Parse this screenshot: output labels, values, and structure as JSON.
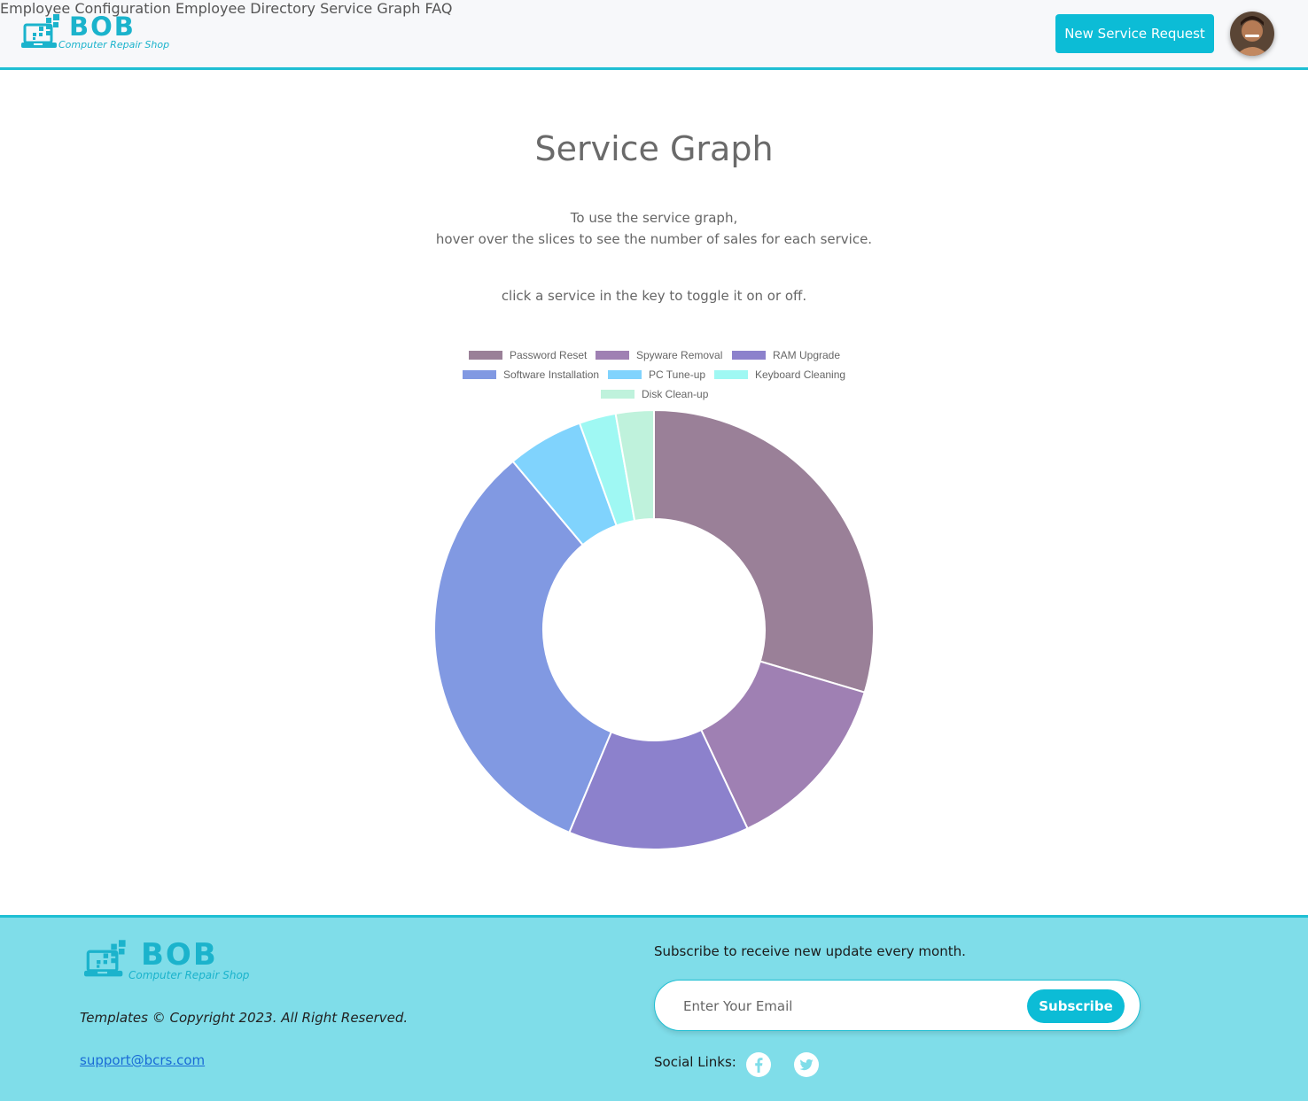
{
  "brand": {
    "name": "BOB",
    "tagline": "Computer Repair Shop",
    "primary_color": "#0cbcd6",
    "logo_icon": "laptop-pixels-logo"
  },
  "nav": {
    "items": [
      {
        "label": "Employee Configuration"
      },
      {
        "label": "Employee Directory"
      },
      {
        "label": "Service Graph"
      },
      {
        "label": "FAQ"
      }
    ],
    "cta_label": "New Service Request",
    "avatar_icon": "user-avatar"
  },
  "main": {
    "title": "Service Graph",
    "instructions_line1": "To use the service graph,",
    "instructions_line2": "hover over the slices to see the number of sales for each service.",
    "instructions_line3": "click a service in the key to toggle it on or off."
  },
  "chart_data": {
    "type": "doughnut",
    "legend_position": "top",
    "categories": [
      "Password Reset",
      "Spyware Removal",
      "RAM Upgrade",
      "Software Installation",
      "PC Tune-up",
      "Keyboard Cleaning",
      "Disk Clean-up"
    ],
    "values": [
      29.6,
      13.4,
      13.3,
      32.6,
      5.6,
      2.7,
      2.8
    ],
    "colors": [
      "#9a8098",
      "#9f80b3",
      "#8c81cc",
      "#8199e2",
      "#80d3fd",
      "#9ff8f3",
      "#bff2dc"
    ]
  },
  "footer": {
    "copyright": "Templates © Copyright 2023. All Right Reserved.",
    "support_email": "support@bcrs.com",
    "subscribe_heading": "Subscribe to receive new update every month.",
    "email_placeholder": "Enter Your Email",
    "subscribe_label": "Subscribe",
    "social_label": "Social Links:",
    "social_icons": [
      "facebook-icon",
      "twitter-icon"
    ]
  }
}
